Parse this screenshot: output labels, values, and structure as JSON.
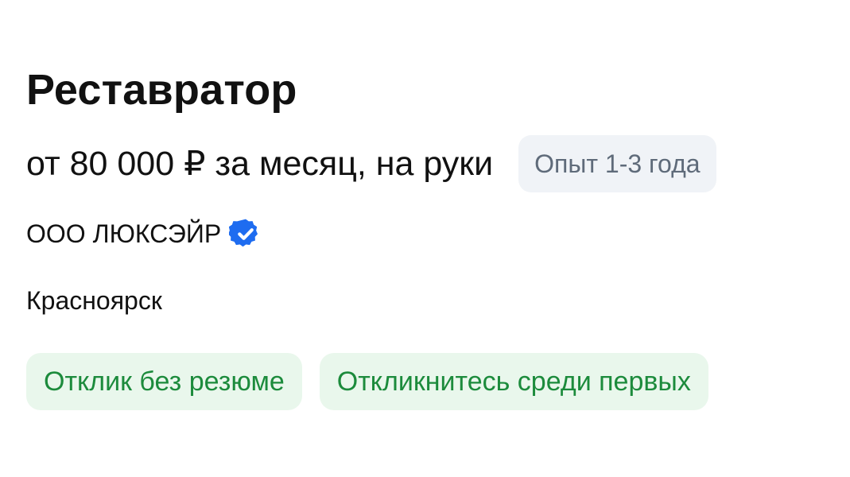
{
  "vacancy": {
    "title": "Реставратор",
    "salary": "от 80 000 ₽ за месяц, на руки",
    "experience_badge": "Опыт 1-3 года",
    "company": "ООО ЛЮКСЭЙР",
    "company_verified_icon": "verified-check-icon",
    "city": "Красноярск",
    "tags": [
      "Отклик без резюме",
      "Откликнитесь среди первых"
    ]
  },
  "colors": {
    "verified_blue": "#1e6cf0",
    "tag_background": "#e9f7ec",
    "tag_text": "#1c8b3c",
    "badge_background": "#f0f3f7",
    "badge_text": "#5f6b7a"
  }
}
